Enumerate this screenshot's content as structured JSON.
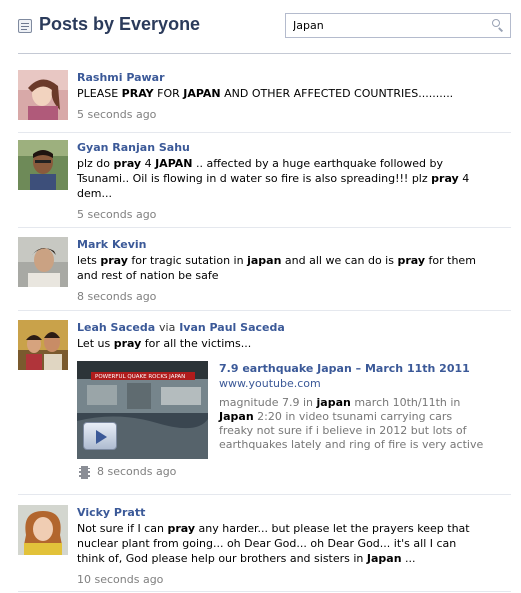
{
  "header": {
    "title": "Posts by Everyone",
    "search": {
      "value": "Japan",
      "placeholder": ""
    }
  },
  "posts": [
    {
      "author": "Rashmi Pawar",
      "message_parts": [
        {
          "t": "PLEASE ",
          "b": false
        },
        {
          "t": "PRAY",
          "b": true
        },
        {
          "t": " FOR ",
          "b": false
        },
        {
          "t": "JAPAN",
          "b": true
        },
        {
          "t": " AND OTHER AFFECTED COUNTRIES..........",
          "b": false
        }
      ],
      "time": "5 seconds ago"
    },
    {
      "author": "Gyan Ranjan Sahu",
      "message_parts": [
        {
          "t": "plz do ",
          "b": false
        },
        {
          "t": "pray",
          "b": true
        },
        {
          "t": " 4 ",
          "b": false
        },
        {
          "t": "JAPAN",
          "b": true
        },
        {
          "t": " .. affected by a huge earthquake followed by Tsunami.. Oil is flowing in d water so fire is also spreading!!! plz ",
          "b": false
        },
        {
          "t": "pray",
          "b": true
        },
        {
          "t": " 4 dem...",
          "b": false
        }
      ],
      "time": "5 seconds ago"
    },
    {
      "author": "Mark Kevin",
      "message_parts": [
        {
          "t": "lets ",
          "b": false
        },
        {
          "t": "pray",
          "b": true
        },
        {
          "t": " for tragic sutation in ",
          "b": false
        },
        {
          "t": "japan",
          "b": true
        },
        {
          "t": " and all we can do is ",
          "b": false
        },
        {
          "t": "pray",
          "b": true
        },
        {
          "t": " for them and rest of nation be safe",
          "b": false
        }
      ],
      "time": "8 seconds ago"
    },
    {
      "author": "Leah Saceda",
      "via_text": "via",
      "via_author": "Ivan Paul Saceda",
      "message_parts": [
        {
          "t": "Let us ",
          "b": false
        },
        {
          "t": "pray",
          "b": true
        },
        {
          "t": " for all the victims...",
          "b": false
        }
      ],
      "attachment": {
        "thumb_caption": "POWERFUL QUAKE ROCKS JAPAN",
        "title_parts": [
          {
            "t": "7.9 earthquake ",
            "b": false
          },
          {
            "t": "Japan",
            "b": true
          },
          {
            "t": " – March 11th 2011",
            "b": false
          }
        ],
        "url": "www.youtube.com",
        "desc_parts": [
          {
            "t": "magnitude 7.9 in ",
            "b": false
          },
          {
            "t": "japan",
            "b": true
          },
          {
            "t": " march 10th/11th in ",
            "b": false
          },
          {
            "t": "Japan",
            "b": true
          },
          {
            "t": " 2:20 in video tsunami carrying cars freaky not sure if i believe in 2012 but lots of earthquakes lately and ring of fire is very active",
            "b": false
          }
        ]
      },
      "time": "8 seconds ago"
    },
    {
      "author": "Vicky Pratt",
      "message_parts": [
        {
          "t": "Not sure if I can ",
          "b": false
        },
        {
          "t": "pray",
          "b": true
        },
        {
          "t": " any harder... but please let the prayers keep that nuclear plant from going... oh Dear God... oh Dear God... it's all I can think of, God please help our brothers and sisters in ",
          "b": false
        },
        {
          "t": "Japan",
          "b": true
        },
        {
          "t": " ...",
          "b": false
        }
      ],
      "time": "10 seconds ago"
    }
  ],
  "colors": {
    "title": "#2b3b5b",
    "link": "#3b5998",
    "muted": "#808080",
    "divider": "#e5e8ee"
  },
  "icons": {
    "header": "posts-list-icon",
    "search": "magnifier-icon",
    "attachment_time": "film-strip-icon",
    "video": "play-icon"
  }
}
